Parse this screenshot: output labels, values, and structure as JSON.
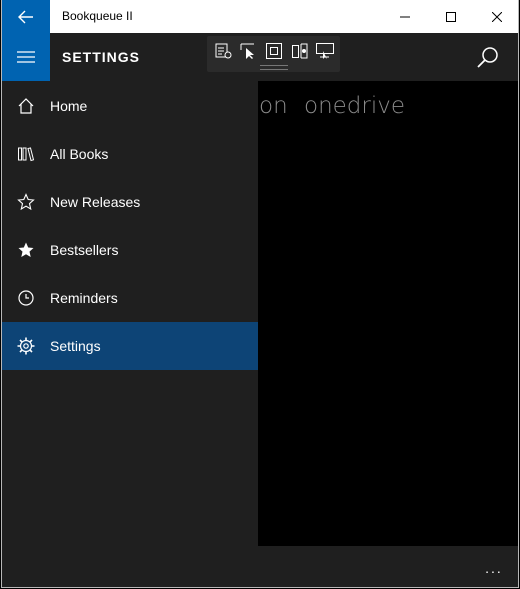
{
  "window": {
    "title": "Bookqueue II"
  },
  "header": {
    "title": "SETTINGS"
  },
  "pivot": {
    "items": [
      "on",
      "onedrive"
    ]
  },
  "nav": {
    "items": [
      {
        "label": "Home",
        "icon": "home-icon"
      },
      {
        "label": "All Books",
        "icon": "library-icon"
      },
      {
        "label": "New Releases",
        "icon": "star-outline-icon"
      },
      {
        "label": "Bestsellers",
        "icon": "star-filled-icon"
      },
      {
        "label": "Reminders",
        "icon": "clock-icon"
      },
      {
        "label": "Settings",
        "icon": "gear-icon",
        "selected": true
      }
    ]
  },
  "appbar": {
    "more_label": "..."
  },
  "colors": {
    "accent": "#0063b1",
    "selected": "#0d4476",
    "pane": "#1f1f1f"
  }
}
